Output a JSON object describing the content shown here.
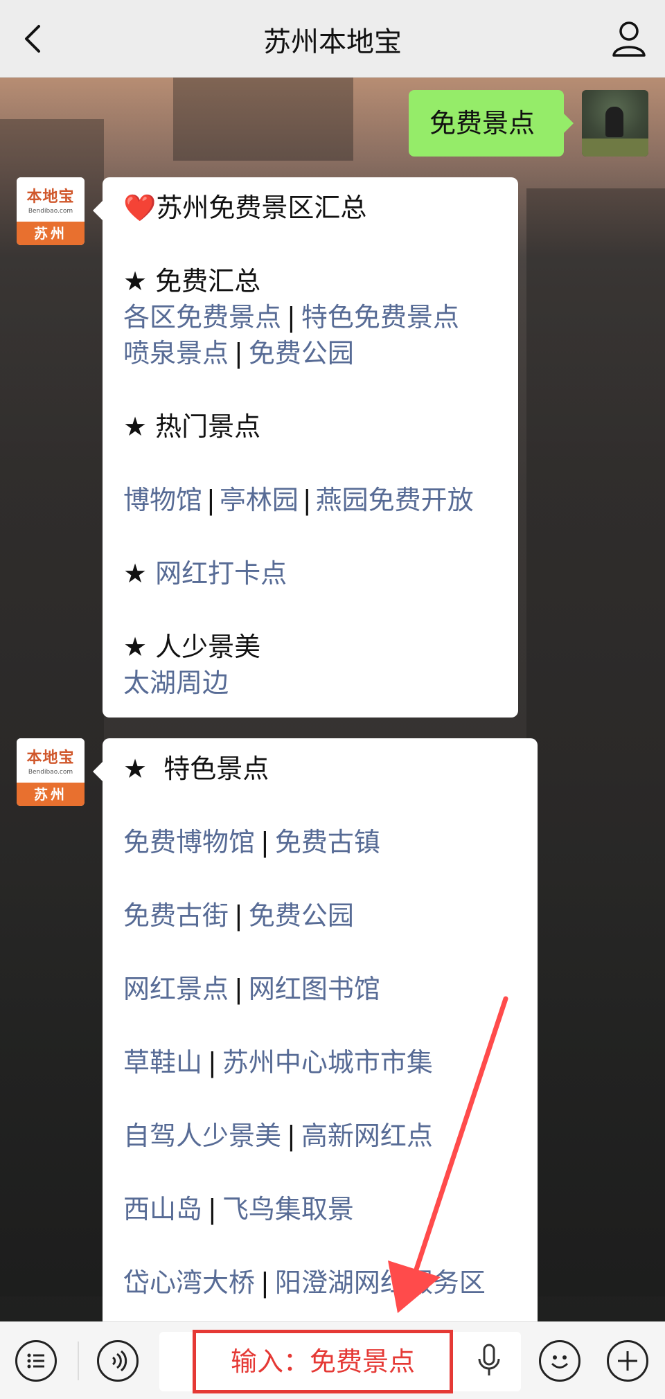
{
  "header": {
    "title": "苏州本地宝"
  },
  "chat": {
    "sent_message": "免费景点",
    "bot_avatar": {
      "logo_text": "本地宝",
      "logo_sub": "Bendibao.com",
      "city": "苏州"
    },
    "bubble1": {
      "heading_icon": "❤️",
      "heading": "苏州免费景区汇总",
      "s1_title": "★ 免费汇总",
      "s1_l1_a": "各区免费景点",
      "s1_l1_b": "特色免费景点",
      "s1_l2_a": "喷泉景点",
      "s1_l2_b": "免费公园",
      "s2_title": "★ 热门景点",
      "s2_a": "博物馆",
      "s2_b": "亭林园",
      "s2_c": "燕园免费开放",
      "s3_star": "★",
      "s3_link": "网红打卡点",
      "s4_title": "★ 人少景美",
      "s4_link": "太湖周边"
    },
    "bubble2": {
      "title": "★  特色景点",
      "rows": [
        [
          "免费博物馆",
          "免费古镇"
        ],
        [
          "免费古街",
          "免费公园"
        ],
        [
          "网红景点",
          "网红图书馆"
        ],
        [
          "草鞋山",
          "苏州中心城市市集"
        ],
        [
          "自驾人少景美",
          "高新网红点"
        ],
        [
          "西山岛",
          "飞鸟集取景"
        ],
        [
          "岱心湾大桥",
          "阳澄湖网红服务区"
        ]
      ],
      "separator": "|"
    }
  },
  "bottom_bar": {
    "input_hint": "输入：免费景点"
  },
  "colors": {
    "link": "#576b95",
    "sent_bubble": "#95ec69",
    "annotation": "#e53935"
  }
}
